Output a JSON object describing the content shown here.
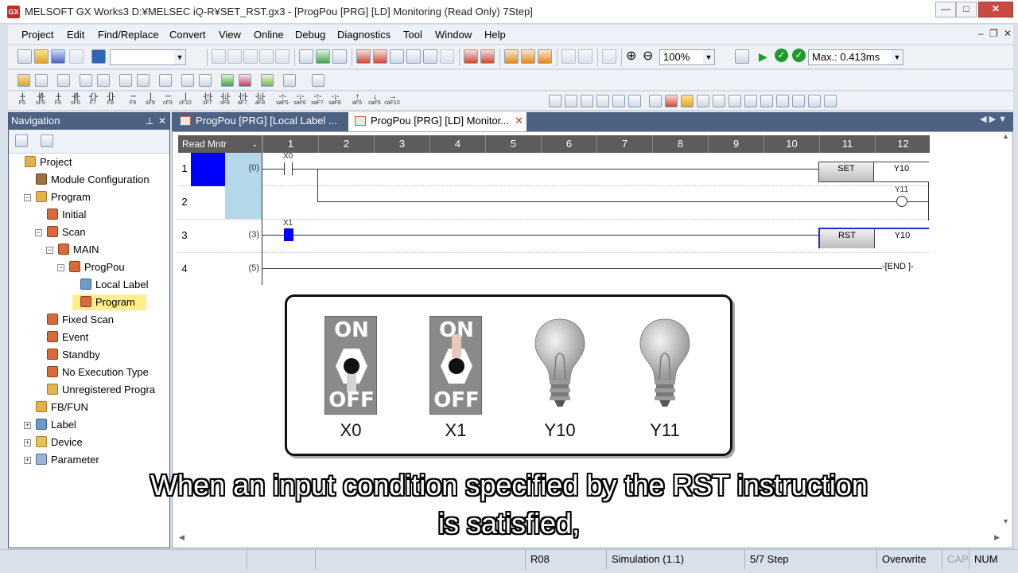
{
  "window": {
    "title": "MELSOFT GX Works3 D:¥MELSEC iQ-R¥SET_RST.gx3 - [ProgPou [PRG] [LD] Monitoring (Read Only) 7Step]",
    "app_icon_text": "GX"
  },
  "menu": [
    "Project",
    "Edit",
    "Find/Replace",
    "Convert",
    "View",
    "Online",
    "Debug",
    "Diagnostics",
    "Tool",
    "Window",
    "Help"
  ],
  "toolbar": {
    "zoom": "100%",
    "scan_time": "Max.: 0.413ms",
    "fkeys": [
      {
        "t": "-|-",
        "k": "F5"
      },
      {
        "t": "-|/|-",
        "k": "sF5"
      },
      {
        "t": "-|-",
        "k": "F6"
      },
      {
        "t": "-|/|-",
        "k": "sF6"
      },
      {
        "t": "-( )-",
        "k": "F7"
      },
      {
        "t": "-[ ]-",
        "k": "F8"
      },
      {
        "t": "─",
        "k": "F9"
      },
      {
        "t": "|",
        "k": "sF9"
      },
      {
        "t": "─",
        "k": "cF9"
      },
      {
        "t": "|",
        "k": "cF10"
      },
      {
        "t": "-|↑|-",
        "k": "sF7"
      },
      {
        "t": "-|↓|-",
        "k": "sF8"
      },
      {
        "t": "-|↑|-",
        "k": "aF7"
      },
      {
        "t": "-|↓|-",
        "k": "aF8"
      },
      {
        "t": "-↑-",
        "k": "saF5"
      },
      {
        "t": "-↓-",
        "k": "saF6"
      },
      {
        "t": "-↑-",
        "k": "saF7"
      },
      {
        "t": "-↓-",
        "k": "saF8"
      },
      {
        "t": "↑",
        "k": "aF5"
      },
      {
        "t": "↓",
        "k": "caF5"
      },
      {
        "t": "→",
        "k": "caF10"
      }
    ]
  },
  "navigation": {
    "title": "Navigation",
    "tree": [
      {
        "label": "Project",
        "indent": 0,
        "icon": "ic-folder",
        "exp": ""
      },
      {
        "label": "Module Configuration",
        "indent": 1,
        "icon": "ic-module",
        "exp": ""
      },
      {
        "label": "Program",
        "indent": 1,
        "icon": "ic-folder",
        "exp": "−"
      },
      {
        "label": "Initial",
        "indent": 2,
        "icon": "ic-prog",
        "exp": ""
      },
      {
        "label": "Scan",
        "indent": 2,
        "icon": "ic-prog",
        "exp": "−"
      },
      {
        "label": "MAIN",
        "indent": 3,
        "icon": "ic-prog",
        "exp": "−"
      },
      {
        "label": "ProgPou",
        "indent": 4,
        "icon": "ic-prog",
        "exp": "−"
      },
      {
        "label": "Local Label",
        "indent": 5,
        "icon": "ic-label",
        "exp": ""
      },
      {
        "label": "Program",
        "indent": 5,
        "icon": "ic-prog",
        "exp": "",
        "selected": true
      },
      {
        "label": "Fixed Scan",
        "indent": 2,
        "icon": "ic-prog",
        "exp": ""
      },
      {
        "label": "Event",
        "indent": 2,
        "icon": "ic-prog",
        "exp": ""
      },
      {
        "label": "Standby",
        "indent": 2,
        "icon": "ic-prog",
        "exp": ""
      },
      {
        "label": "No Execution Type",
        "indent": 2,
        "icon": "ic-prog",
        "exp": ""
      },
      {
        "label": "Unregistered Progra",
        "indent": 2,
        "icon": "ic-folder",
        "exp": ""
      },
      {
        "label": "FB/FUN",
        "indent": 1,
        "icon": "ic-folder",
        "exp": ""
      },
      {
        "label": "Label",
        "indent": 1,
        "icon": "ic-label",
        "exp": "+"
      },
      {
        "label": "Device",
        "indent": 1,
        "icon": "ic-device",
        "exp": "+"
      },
      {
        "label": "Parameter",
        "indent": 1,
        "icon": "ic-param",
        "exp": "+"
      }
    ]
  },
  "tabs": [
    {
      "label": "ProgPou [PRG] [Local Label ...",
      "active": false
    },
    {
      "label": "ProgPou [PRG] [LD] Monitor...",
      "active": true
    }
  ],
  "ladder": {
    "mode": "Read Mntr",
    "columns": [
      "1",
      "2",
      "3",
      "4",
      "5",
      "6",
      "7",
      "8",
      "9",
      "10",
      "11",
      "12"
    ],
    "rows": [
      "1",
      "2",
      "3",
      "4"
    ],
    "steps": [
      "(0)",
      "(3)",
      "(5)"
    ],
    "contact_x0": "X0",
    "contact_x1": "X1",
    "set_instr": "SET",
    "set_op": "Y10",
    "coil_y11": "Y11",
    "rst_instr": "RST",
    "rst_op": "Y10",
    "end": "END"
  },
  "popup": {
    "switch_on": "ON",
    "switch_off": "OFF",
    "devices": [
      "X0",
      "X1",
      "Y10",
      "Y11"
    ],
    "x0_state": "OFF",
    "x1_state": "ON",
    "y10_state": "OFF",
    "y11_state": "OFF"
  },
  "caption": {
    "line1": "When an input condition specified by the RST instruction",
    "line2": "is satisfied,"
  },
  "statusbar": {
    "cpu": "R08",
    "connection": "Simulation (1.1)",
    "step": "5/7 Step",
    "mode": "Overwrite",
    "caps": "CAP",
    "num": "NUM"
  }
}
